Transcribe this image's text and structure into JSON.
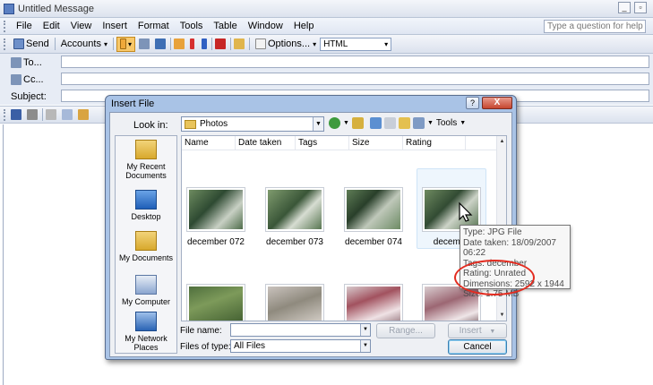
{
  "window": {
    "title": "Untitled Message",
    "minimize_glyph": "_",
    "restore_glyph": "▫"
  },
  "menu": {
    "items": [
      "File",
      "Edit",
      "View",
      "Insert",
      "Format",
      "Tools",
      "Table",
      "Window",
      "Help"
    ],
    "ask_placeholder": "Type a question for help"
  },
  "toolbar": {
    "send_label": "Send",
    "accounts_label": "Accounts",
    "options_label": "Options...",
    "format_value": "HTML",
    "dropdown_glyph": "▾"
  },
  "headers": {
    "to_label": "To...",
    "cc_label": "Cc...",
    "subject_label": "Subject:"
  },
  "dialog": {
    "title": "Insert File",
    "help_glyph": "?",
    "close_glyph": "X",
    "look_in_label": "Look in:",
    "look_in_value": "Photos",
    "tools_label": "Tools",
    "places": [
      "My Recent Documents",
      "Desktop",
      "My Documents",
      "My Computer",
      "My Network Places"
    ],
    "columns": [
      "Name",
      "Date taken",
      "Tags",
      "Size",
      "Rating"
    ],
    "files": [
      "december 072",
      "december 073",
      "december 074",
      "december"
    ],
    "file_name_label": "File name:",
    "file_name_value": "",
    "file_type_label": "Files of type:",
    "file_type_value": "All Files",
    "range_label": "Range...",
    "insert_label": "Insert",
    "cancel_label": "Cancel",
    "scroll_up_glyph": "▲",
    "scroll_down_glyph": "▼"
  },
  "tooltip": {
    "type": "Type: JPG File",
    "date_taken": "Date taken: 18/09/2007 06:22",
    "tags": "Tags: december",
    "rating": "Rating: Unrated",
    "dimensions": "Dimensions: 2592 x 1944",
    "size": "Size: 1.75 MB"
  },
  "colors": {
    "annotation_circle": "#e32b1f",
    "dialog_frame": "#a9c3e6",
    "toolbar_bg": "#dbe2ee"
  }
}
